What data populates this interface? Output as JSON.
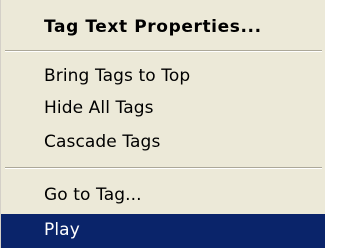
{
  "context_menu": {
    "items": [
      {
        "label": "Tag Text Properties...",
        "default": true
      },
      {
        "label": "Bring Tags to Top"
      },
      {
        "label": "Hide All Tags"
      },
      {
        "label": "Cascade Tags"
      },
      {
        "label": "Go to Tag..."
      },
      {
        "label": "Play",
        "selected": true
      }
    ]
  },
  "colors": {
    "menu_background": "#ece9d8",
    "highlight_background": "#0a246a",
    "highlight_text": "#ffffff",
    "separator_shadow": "#aca899"
  }
}
